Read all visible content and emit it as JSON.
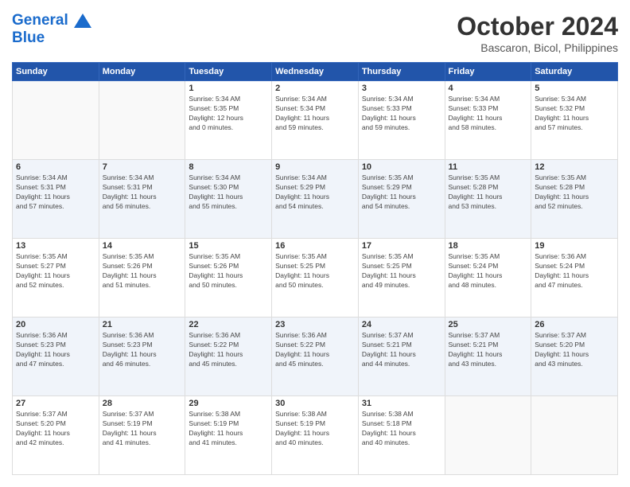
{
  "header": {
    "logo_line1": "General",
    "logo_line2": "Blue",
    "month_year": "October 2024",
    "location": "Bascaron, Bicol, Philippines"
  },
  "days_of_week": [
    "Sunday",
    "Monday",
    "Tuesday",
    "Wednesday",
    "Thursday",
    "Friday",
    "Saturday"
  ],
  "weeks": [
    [
      {
        "day": "",
        "info": ""
      },
      {
        "day": "",
        "info": ""
      },
      {
        "day": "1",
        "info": "Sunrise: 5:34 AM\nSunset: 5:35 PM\nDaylight: 12 hours\nand 0 minutes."
      },
      {
        "day": "2",
        "info": "Sunrise: 5:34 AM\nSunset: 5:34 PM\nDaylight: 11 hours\nand 59 minutes."
      },
      {
        "day": "3",
        "info": "Sunrise: 5:34 AM\nSunset: 5:33 PM\nDaylight: 11 hours\nand 59 minutes."
      },
      {
        "day": "4",
        "info": "Sunrise: 5:34 AM\nSunset: 5:33 PM\nDaylight: 11 hours\nand 58 minutes."
      },
      {
        "day": "5",
        "info": "Sunrise: 5:34 AM\nSunset: 5:32 PM\nDaylight: 11 hours\nand 57 minutes."
      }
    ],
    [
      {
        "day": "6",
        "info": "Sunrise: 5:34 AM\nSunset: 5:31 PM\nDaylight: 11 hours\nand 57 minutes."
      },
      {
        "day": "7",
        "info": "Sunrise: 5:34 AM\nSunset: 5:31 PM\nDaylight: 11 hours\nand 56 minutes."
      },
      {
        "day": "8",
        "info": "Sunrise: 5:34 AM\nSunset: 5:30 PM\nDaylight: 11 hours\nand 55 minutes."
      },
      {
        "day": "9",
        "info": "Sunrise: 5:34 AM\nSunset: 5:29 PM\nDaylight: 11 hours\nand 54 minutes."
      },
      {
        "day": "10",
        "info": "Sunrise: 5:35 AM\nSunset: 5:29 PM\nDaylight: 11 hours\nand 54 minutes."
      },
      {
        "day": "11",
        "info": "Sunrise: 5:35 AM\nSunset: 5:28 PM\nDaylight: 11 hours\nand 53 minutes."
      },
      {
        "day": "12",
        "info": "Sunrise: 5:35 AM\nSunset: 5:28 PM\nDaylight: 11 hours\nand 52 minutes."
      }
    ],
    [
      {
        "day": "13",
        "info": "Sunrise: 5:35 AM\nSunset: 5:27 PM\nDaylight: 11 hours\nand 52 minutes."
      },
      {
        "day": "14",
        "info": "Sunrise: 5:35 AM\nSunset: 5:26 PM\nDaylight: 11 hours\nand 51 minutes."
      },
      {
        "day": "15",
        "info": "Sunrise: 5:35 AM\nSunset: 5:26 PM\nDaylight: 11 hours\nand 50 minutes."
      },
      {
        "day": "16",
        "info": "Sunrise: 5:35 AM\nSunset: 5:25 PM\nDaylight: 11 hours\nand 50 minutes."
      },
      {
        "day": "17",
        "info": "Sunrise: 5:35 AM\nSunset: 5:25 PM\nDaylight: 11 hours\nand 49 minutes."
      },
      {
        "day": "18",
        "info": "Sunrise: 5:35 AM\nSunset: 5:24 PM\nDaylight: 11 hours\nand 48 minutes."
      },
      {
        "day": "19",
        "info": "Sunrise: 5:36 AM\nSunset: 5:24 PM\nDaylight: 11 hours\nand 47 minutes."
      }
    ],
    [
      {
        "day": "20",
        "info": "Sunrise: 5:36 AM\nSunset: 5:23 PM\nDaylight: 11 hours\nand 47 minutes."
      },
      {
        "day": "21",
        "info": "Sunrise: 5:36 AM\nSunset: 5:23 PM\nDaylight: 11 hours\nand 46 minutes."
      },
      {
        "day": "22",
        "info": "Sunrise: 5:36 AM\nSunset: 5:22 PM\nDaylight: 11 hours\nand 45 minutes."
      },
      {
        "day": "23",
        "info": "Sunrise: 5:36 AM\nSunset: 5:22 PM\nDaylight: 11 hours\nand 45 minutes."
      },
      {
        "day": "24",
        "info": "Sunrise: 5:37 AM\nSunset: 5:21 PM\nDaylight: 11 hours\nand 44 minutes."
      },
      {
        "day": "25",
        "info": "Sunrise: 5:37 AM\nSunset: 5:21 PM\nDaylight: 11 hours\nand 43 minutes."
      },
      {
        "day": "26",
        "info": "Sunrise: 5:37 AM\nSunset: 5:20 PM\nDaylight: 11 hours\nand 43 minutes."
      }
    ],
    [
      {
        "day": "27",
        "info": "Sunrise: 5:37 AM\nSunset: 5:20 PM\nDaylight: 11 hours\nand 42 minutes."
      },
      {
        "day": "28",
        "info": "Sunrise: 5:37 AM\nSunset: 5:19 PM\nDaylight: 11 hours\nand 41 minutes."
      },
      {
        "day": "29",
        "info": "Sunrise: 5:38 AM\nSunset: 5:19 PM\nDaylight: 11 hours\nand 41 minutes."
      },
      {
        "day": "30",
        "info": "Sunrise: 5:38 AM\nSunset: 5:19 PM\nDaylight: 11 hours\nand 40 minutes."
      },
      {
        "day": "31",
        "info": "Sunrise: 5:38 AM\nSunset: 5:18 PM\nDaylight: 11 hours\nand 40 minutes."
      },
      {
        "day": "",
        "info": ""
      },
      {
        "day": "",
        "info": ""
      }
    ]
  ]
}
